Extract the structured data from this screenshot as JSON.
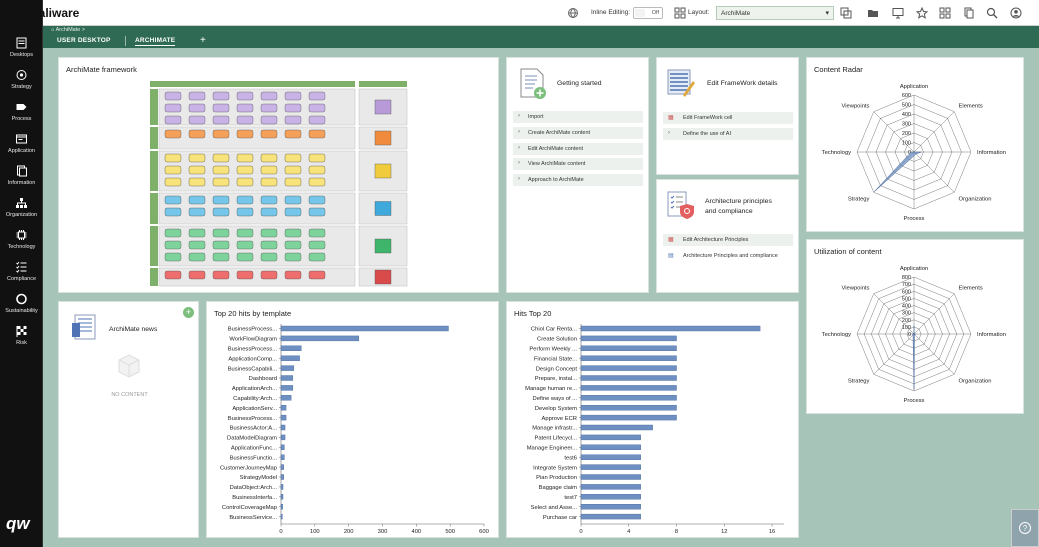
{
  "brand": "qualiware",
  "topbar": {
    "inline_editing_label": "Inline Editing:",
    "inline_editing_state": "Off",
    "layout_label": "Layout:",
    "layout_value": "ArchiMate"
  },
  "breadcrumb": {
    "home": "ArchiMate",
    "sep": ">"
  },
  "tabs": [
    {
      "label": "USER DESKTOP"
    },
    {
      "label": "ARCHIMATE"
    }
  ],
  "tab_add": "+",
  "sidebar": {
    "items": [
      {
        "label": "Desktops",
        "icon": "desktops-icon"
      },
      {
        "label": "Strategy",
        "icon": "strategy-icon"
      },
      {
        "label": "Process",
        "icon": "process-icon"
      },
      {
        "label": "Application",
        "icon": "application-icon"
      },
      {
        "label": "Information",
        "icon": "information-icon"
      },
      {
        "label": "Organization",
        "icon": "organization-icon"
      },
      {
        "label": "Technology",
        "icon": "technology-icon"
      },
      {
        "label": "Compliance",
        "icon": "compliance-icon"
      },
      {
        "label": "Sustainability",
        "icon": "sustainability-icon"
      },
      {
        "label": "Risk",
        "icon": "risk-icon"
      }
    ],
    "bottom_logo": "qw"
  },
  "panels": {
    "framework": {
      "title": "ArchiMate framework"
    },
    "getting_started": {
      "title": "Getting started",
      "items": [
        "Import",
        "Create ArchiMate content",
        "Edit ArchiMate content",
        "View ArchiMate content",
        "Approach to ArchiMate"
      ]
    },
    "edit_framework": {
      "title": "Edit FrameWork details",
      "items": [
        "Edit FrameWork cell",
        "Define the use of AI"
      ]
    },
    "principles": {
      "title_line1": "Architecture principles",
      "title_line2": "and compliance",
      "items": [
        "Edit Architecture Principles",
        "Architecture Principles and compliance"
      ]
    },
    "news": {
      "title": "ArchiMate news",
      "empty": "NO CONTENT"
    },
    "content_radar": {
      "title": "Content Radar"
    },
    "utilization": {
      "title": "Utilization of content"
    },
    "top20_template": {
      "title": "Top 20 hits by template"
    },
    "hits_top20": {
      "title": "Hits Top 20"
    }
  },
  "chart_data": [
    {
      "type": "bar",
      "orientation": "horizontal",
      "title": "Top 20 hits by template",
      "categories": [
        "BusinessProcess...",
        "WorkFlowDiagram",
        "BusinessProcess...",
        "ApplicationComp...",
        "BusinessCapabili...",
        "Dashboard",
        "ApplicationArch...",
        "Capability:Arch...",
        "ApplicationServ...",
        "BusinessProcess...",
        "BusinessActor:A...",
        "DataModelDiagram",
        "ApplicationFunc...",
        "BusinessFunctio...",
        "CustomerJourneyMap",
        "StrategyModel",
        "DataObject:Arch...",
        "BusinessInterfa...",
        "ControlCoverageMap",
        "BusinessService..."
      ],
      "values": [
        495,
        230,
        60,
        55,
        38,
        35,
        35,
        30,
        15,
        15,
        12,
        12,
        10,
        10,
        8,
        8,
        6,
        6,
        5,
        4
      ],
      "xlim": [
        0,
        600
      ],
      "xticks": [
        0,
        100,
        200,
        300,
        400,
        500,
        600
      ],
      "color": "#6e8fc2"
    },
    {
      "type": "bar",
      "orientation": "horizontal",
      "title": "Hits Top 20",
      "categories": [
        "Chiol Car Renta...",
        "Create Solution",
        "Perform Weekly ...",
        "Financial State...",
        "Design Concept",
        "Prepare, instal...",
        "Manage human re...",
        "Define ways of ...",
        "Develop System",
        "Approve ECR",
        "Manage infrastr...",
        "Patent Lifecycl...",
        "Manage Engineer...",
        "test6",
        "Integrate System",
        "Pian Production",
        "Baggage claim",
        "test7",
        "Select and Asse...",
        "Purchase car"
      ],
      "values": [
        15,
        8,
        8,
        8,
        8,
        8,
        8,
        8,
        8,
        8,
        6,
        5,
        5,
        5,
        5,
        5,
        5,
        5,
        5,
        5
      ],
      "xlim": [
        0,
        17
      ],
      "xticks": [
        0,
        4,
        8,
        12,
        16
      ],
      "color": "#6e8fc2"
    },
    {
      "type": "radar",
      "title": "Content Radar",
      "axes": [
        "Application",
        "Elements",
        "Information",
        "Organization",
        "Process",
        "Strategy",
        "Technology",
        "Viewpoints"
      ],
      "ticks": [
        0,
        100,
        200,
        300,
        400,
        500,
        600
      ],
      "values": [
        0,
        0,
        80,
        30,
        40,
        600,
        30,
        0
      ],
      "color": "#6e8fc2"
    },
    {
      "type": "radar",
      "title": "Utilization of content",
      "axes": [
        "Application",
        "Elements",
        "Information",
        "Organization",
        "Process",
        "Strategy",
        "Technology",
        "Viewpoints"
      ],
      "ticks": [
        0,
        100,
        200,
        300,
        400,
        500,
        600,
        700,
        800
      ],
      "values": [
        120,
        0,
        30,
        10,
        780,
        20,
        30,
        0
      ],
      "color": "#6e8fc2"
    }
  ]
}
